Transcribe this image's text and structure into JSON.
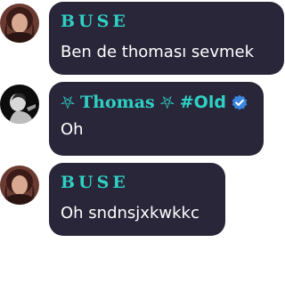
{
  "messages": [
    {
      "author": "BUSE",
      "text": "Ben de thoması sevmek",
      "avatar": "avatar-buse"
    },
    {
      "author_parts": {
        "star_left": "⛧",
        "name": "Thomas",
        "star_right": "⛧",
        "tag": "#Old"
      },
      "text": "Oh",
      "avatar": "avatar-thomas",
      "verified_icon": "verified-badge-icon"
    },
    {
      "author": "BUSE",
      "text": "Oh sndnsjxkwkkc",
      "avatar": "avatar-buse"
    }
  ],
  "colors": {
    "bubble": "#29263a",
    "name": "#2fd0c4",
    "text": "#ffffff",
    "verified": "#3a86e0"
  }
}
